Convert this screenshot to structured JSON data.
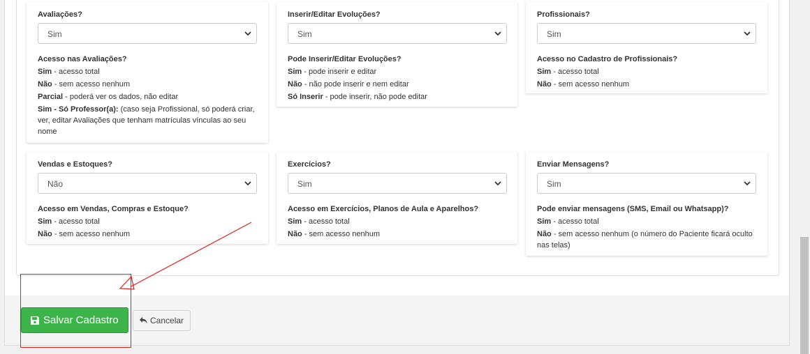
{
  "cards": [
    {
      "title": "Avaliações?",
      "value": "Sim",
      "heading": "Acesso nas Avaliações?",
      "lines": [
        {
          "key": "Sim",
          "text": " - acesso total"
        },
        {
          "key": "Não",
          "text": " - sem acesso nenhum"
        },
        {
          "key": "Parcial",
          "text": " - poderá ver os dados, não editar"
        },
        {
          "key": "Sim - Só Professor(a):",
          "text": " (caso seja Profissional, só poderá criar, ver, editar Avaliações que tenham matrículas vínculas ao seu nome"
        }
      ]
    },
    {
      "title": "Inserir/Editar Evoluções?",
      "value": "Sim",
      "heading": "Pode Inserir/Editar Evoluções?",
      "lines": [
        {
          "key": "Sim",
          "text": " - pode inserir e editar"
        },
        {
          "key": "Não",
          "text": " - não pode inserir e nem editar"
        },
        {
          "key": "Só Inserir",
          "text": " - pode inserir, não pode editar"
        }
      ]
    },
    {
      "title": "Profissionais?",
      "value": "Sim",
      "heading": "Acesso no Cadastro de Profissionais?",
      "lines": [
        {
          "key": "Sim",
          "text": " - acesso total"
        },
        {
          "key": "Não",
          "text": " - sem acesso nenhum"
        }
      ]
    },
    {
      "title": "Vendas e Estoques?",
      "value": "Não",
      "heading": "Acesso em Vendas, Compras e Estoque?",
      "lines": [
        {
          "key": "Sim",
          "text": " - acesso total"
        },
        {
          "key": "Não",
          "text": " - sem acesso nenhum"
        }
      ]
    },
    {
      "title": "Exercícios?",
      "value": "Sim",
      "heading": "Acesso em Exercícios, Planos de Aula e Aparelhos?",
      "lines": [
        {
          "key": "Sim",
          "text": " - acesso total"
        },
        {
          "key": "Não",
          "text": " - sem acesso nenhum"
        }
      ]
    },
    {
      "title": "Enviar Mensagens?",
      "value": "Sim",
      "heading": "Pode enviar mensagens (SMS, Email ou Whatsapp)?",
      "lines": [
        {
          "key": "Sim",
          "text": " - acesso total"
        },
        {
          "key": "Não",
          "text": " - sem acesso nenhum (o número do Paciente ficará oculto nas telas)"
        }
      ]
    }
  ],
  "footer": {
    "save_label": "Salvar Cadastro",
    "save_icon": "floppy-disk-icon",
    "cancel_label": "Cancelar",
    "cancel_icon": "undo-arrow-icon"
  },
  "colors": {
    "save_button": "#3bb54a",
    "annotation": "#e0201c"
  }
}
